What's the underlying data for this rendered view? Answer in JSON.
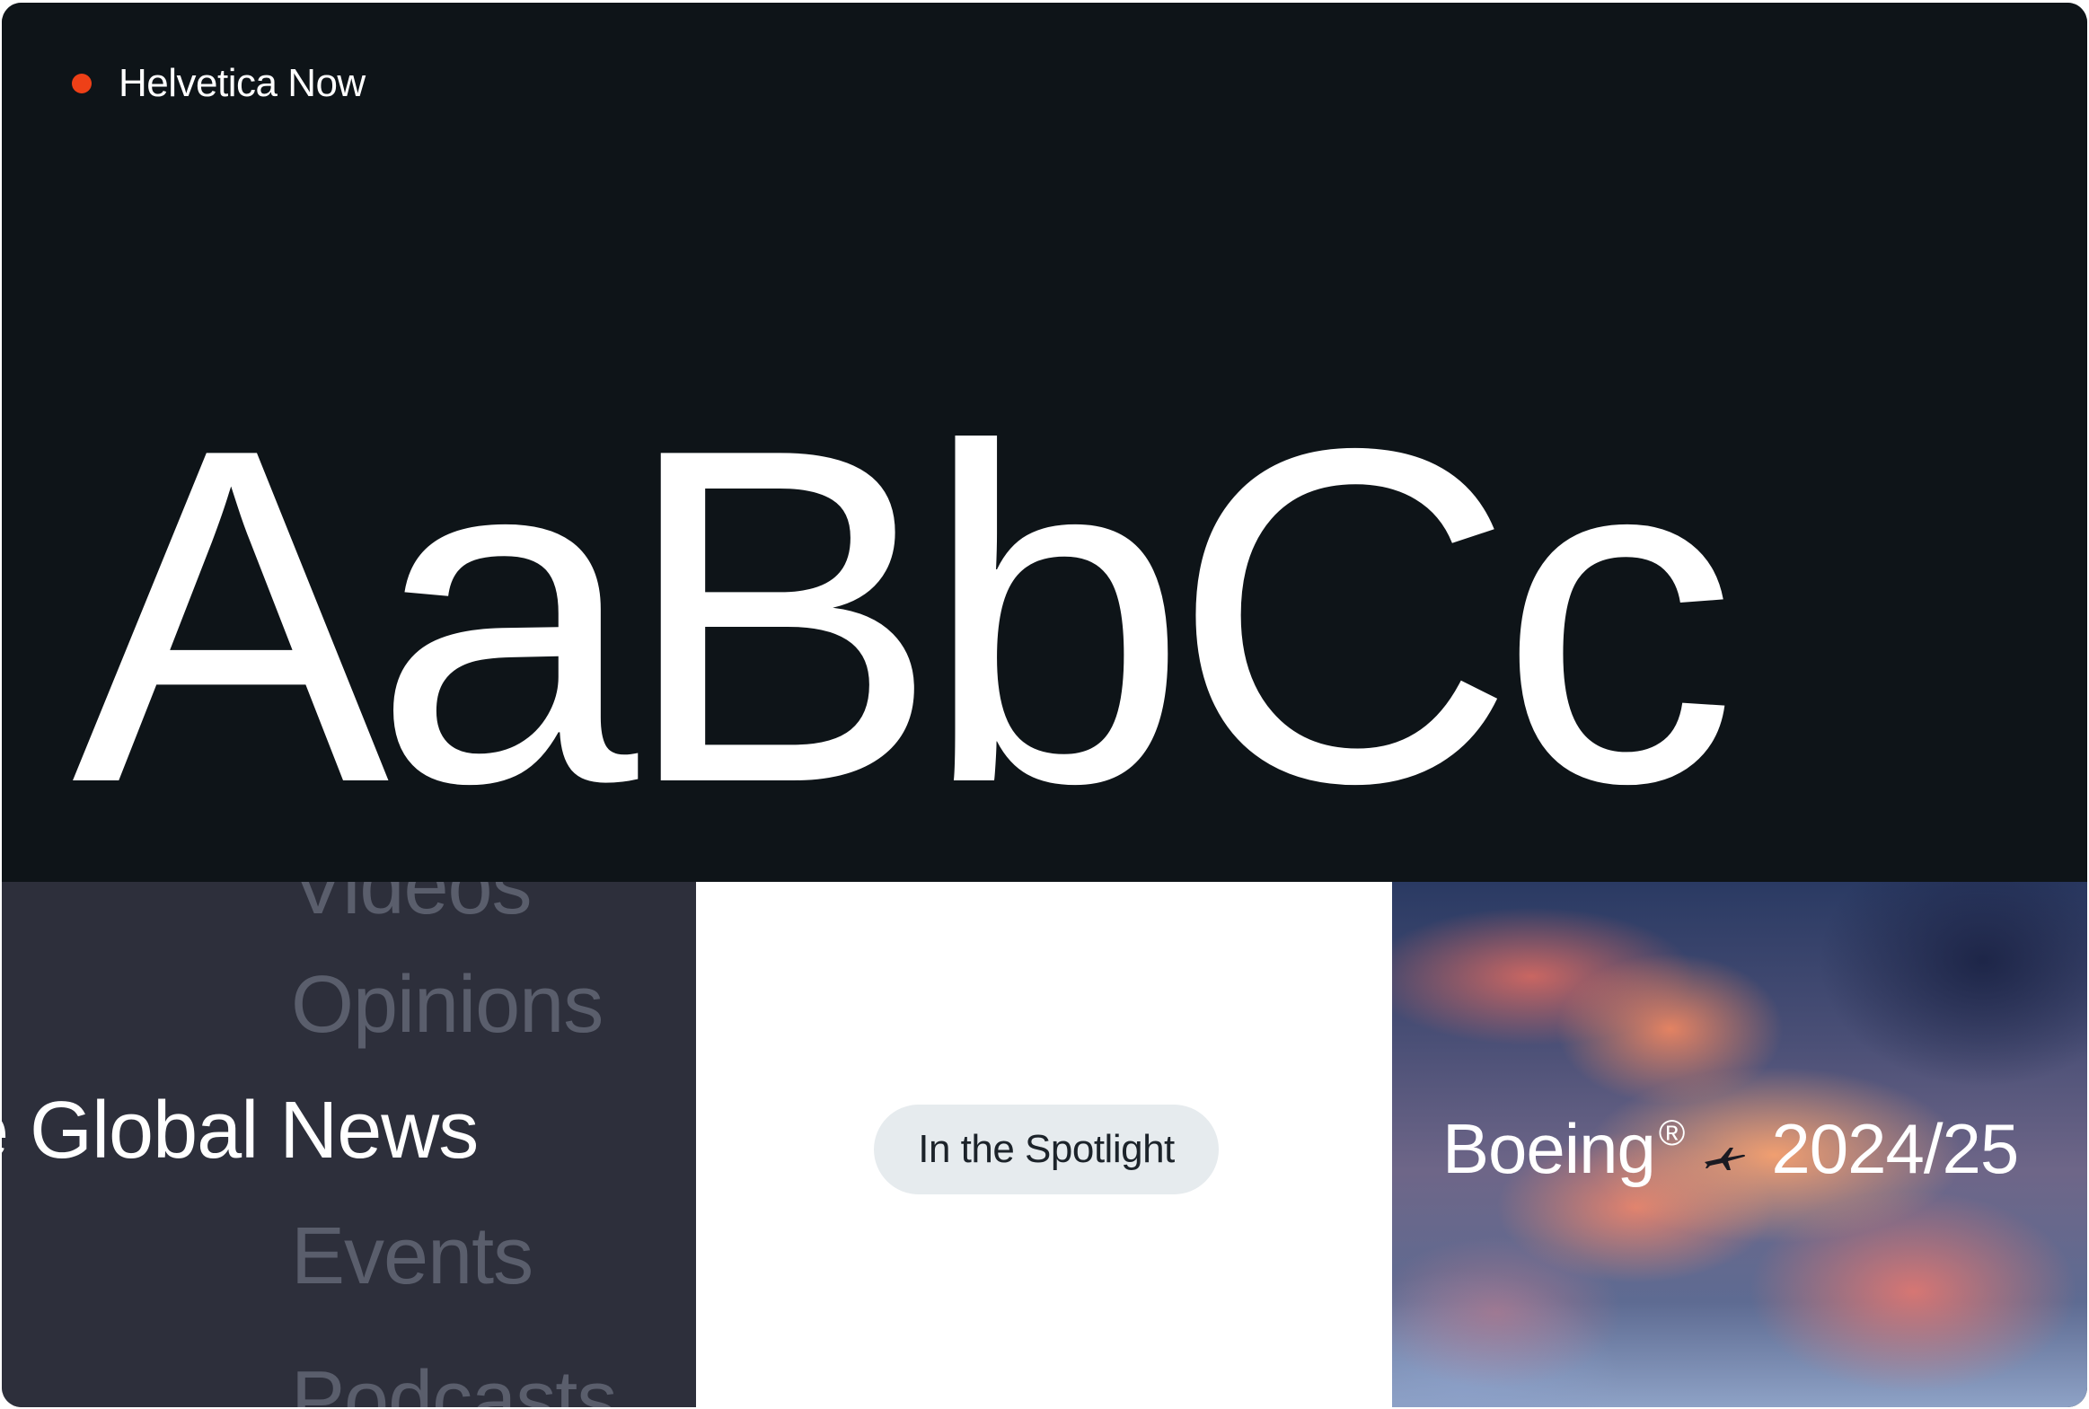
{
  "brand": {
    "name": "Helvetica Now",
    "dot_color": "#ee4017"
  },
  "hero": {
    "specimen": "AaBbCc",
    "background": "#0e1418"
  },
  "nav": {
    "items": [
      {
        "label": "Videos",
        "active": false
      },
      {
        "label": "Opinions",
        "active": false
      },
      {
        "label": "e Global News",
        "active": true
      },
      {
        "label": "Events",
        "active": false
      },
      {
        "label": "Podcasts",
        "active": false
      }
    ]
  },
  "spotlight": {
    "label": "In the Spotlight"
  },
  "photo": {
    "brand": "Boeing",
    "registered": "®",
    "icon": "airplane-icon",
    "year": "2024/25"
  }
}
